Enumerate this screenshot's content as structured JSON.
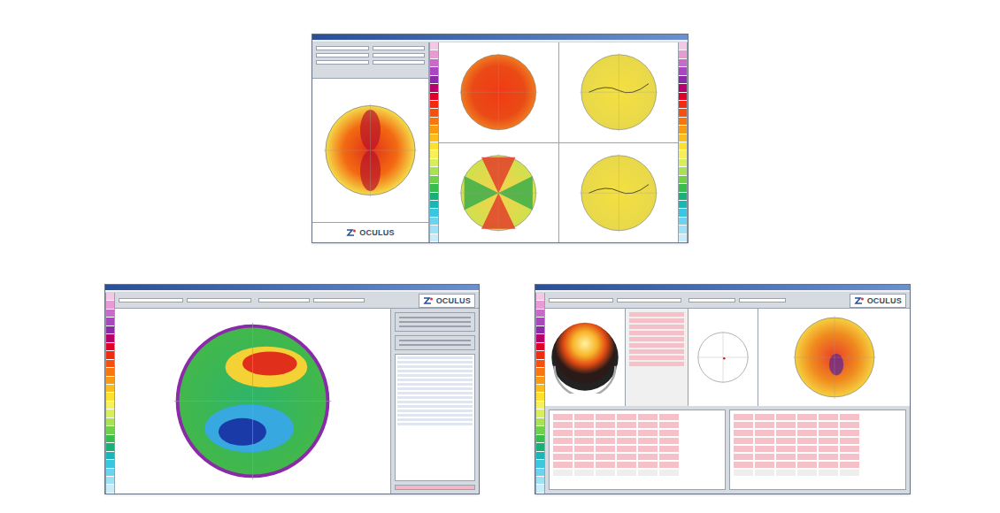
{
  "windows": [
    {
      "kind": "overview",
      "logo": "OCULUS"
    },
    {
      "kind": "zernike",
      "logo": "OCULUS"
    },
    {
      "kind": "holladay",
      "logo": "OCULUS"
    }
  ]
}
